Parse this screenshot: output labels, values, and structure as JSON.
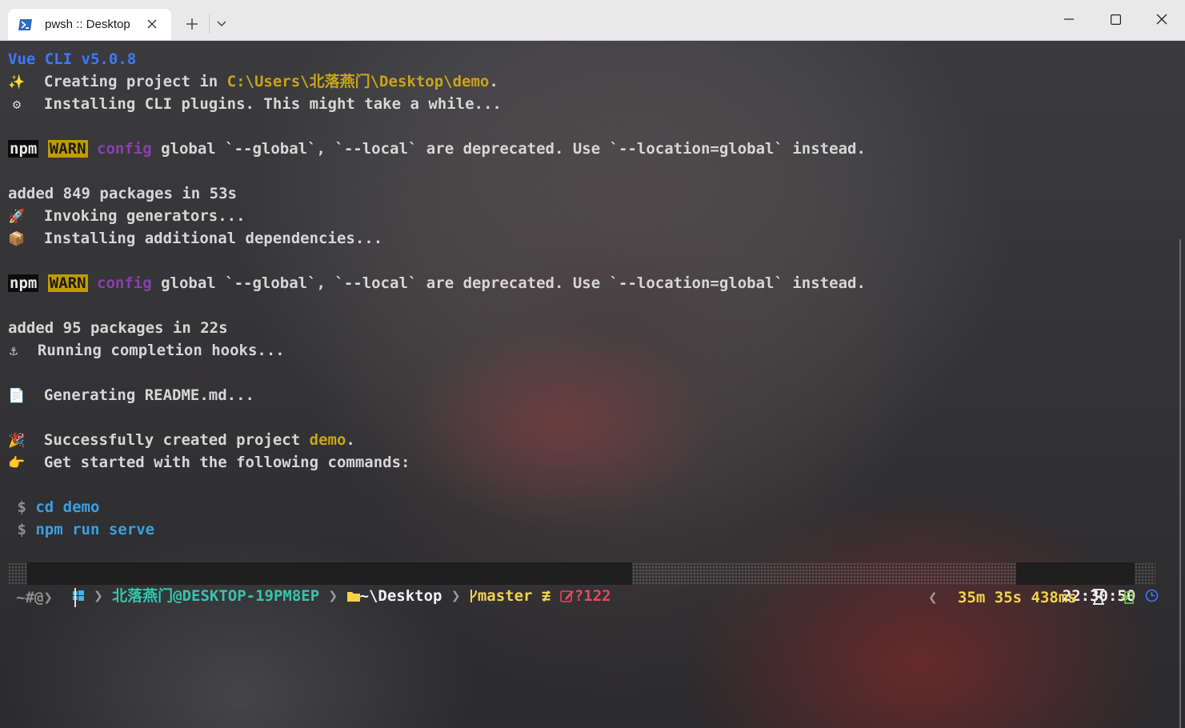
{
  "window": {
    "tab_title": "pwsh :: Desktop",
    "tab_icon": "powershell-icon",
    "new_tab_icon": "plus-icon",
    "dropdown_icon": "chevron-down-icon"
  },
  "terminal": {
    "header": "Vue CLI v5.0.8",
    "creating_prefix": "Creating project in ",
    "creating_path": "C:\\Users\\北落燕门\\Desktop\\demo",
    "creating_suffix": ".",
    "installing_plugins": "Installing CLI plugins. This might take a while...",
    "npm_label": "npm",
    "warn_label": "WARN",
    "config_label": "config",
    "warn_msg": " global `--global`, `--local` are deprecated. Use `--location=global` instead.",
    "added_1": "added 849 packages in 53s",
    "invoking": "Invoking generators...",
    "installing_deps": "Installing additional dependencies...",
    "added_2": "added 95 packages in 22s",
    "completion_hooks": "Running completion hooks...",
    "readme": "Generating README.md...",
    "success_prefix": "Successfully created project ",
    "success_project": "demo",
    "success_suffix": ".",
    "get_started": "Get started with the following commands:",
    "dollar": "$",
    "cmd_1": "cd demo",
    "cmd_2": "npm run serve",
    "emoji": {
      "sparkles": "✨",
      "gear": "⚙",
      "rocket": "🚀",
      "package": "📦",
      "anchor": "⚓",
      "page": "📄",
      "party": "🎉",
      "point": "👉"
    }
  },
  "prompt": {
    "user": "北落燕门",
    "host": "@DESKTOP-19PM8EP",
    "path": "~\\Desktop",
    "branch": "master",
    "git_status": "≢",
    "untracked": "?122",
    "time": "22:30:50",
    "duration": "35m 35s 438ms",
    "input_prompt": "~#@❯",
    "colors": {
      "user": "#35c4ae",
      "branch": "#f3d34a",
      "untracked": "#e8475a",
      "accent_blue": "#3b78ff",
      "warn_bg": "#c19c00"
    }
  }
}
